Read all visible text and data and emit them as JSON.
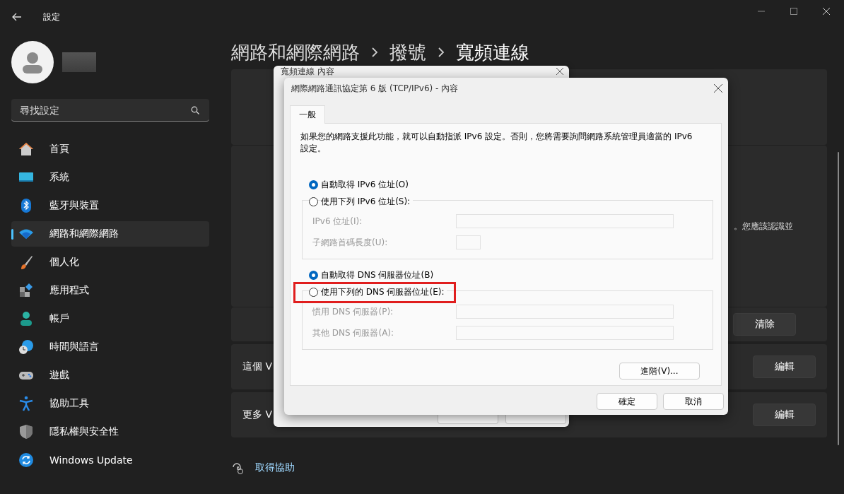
{
  "window": {
    "title": "設定"
  },
  "search": {
    "placeholder": "尋找設定"
  },
  "nav": [
    {
      "label": "首頁",
      "kind": "home",
      "selected": false
    },
    {
      "label": "系統",
      "kind": "system",
      "selected": false
    },
    {
      "label": "藍牙與裝置",
      "kind": "bluetooth",
      "selected": false
    },
    {
      "label": "網路和網際網路",
      "kind": "network",
      "selected": true
    },
    {
      "label": "個人化",
      "kind": "brush",
      "selected": false
    },
    {
      "label": "應用程式",
      "kind": "apps",
      "selected": false
    },
    {
      "label": "帳戶",
      "kind": "account",
      "selected": false
    },
    {
      "label": "時間與語言",
      "kind": "time",
      "selected": false
    },
    {
      "label": "遊戲",
      "kind": "gaming",
      "selected": false
    },
    {
      "label": "協助工具",
      "kind": "accessibility",
      "selected": false
    },
    {
      "label": "隱私權與安全性",
      "kind": "privacy",
      "selected": false
    },
    {
      "label": "Windows Update",
      "kind": "update",
      "selected": false
    }
  ],
  "breadcrumb": [
    "網路和網際網路",
    "撥號",
    "寬頻連線"
  ],
  "cards": [
    {
      "kind": "blank"
    },
    {
      "kind": "note",
      "text": "。您應該認識並"
    },
    {
      "kind": "action",
      "button": "清除"
    },
    {
      "kind": "row",
      "label": "這個 V",
      "button": "編輯"
    },
    {
      "kind": "row",
      "label": "更多 V",
      "button": "編輯"
    }
  ],
  "help_link": "取得協助",
  "back_dialog": {
    "title": "寬頻連線 內容"
  },
  "dialog": {
    "title": "網際網路通訊協定第 6 版 (TCP/IPv6) - 內容",
    "tabs": [
      {
        "label": "一般",
        "selected": true
      }
    ],
    "description": "如果您的網路支援此功能，就可以自動指派 IPv6 設定。否則，您將需要詢問網路系統管理員適當的 IPv6 設定。",
    "sections": [
      {
        "options": [
          {
            "label": "自動取得 IPv6 位址(O)",
            "selected": true
          },
          {
            "label": "使用下列 IPv6 位址(S):",
            "selected": false
          }
        ],
        "fields": [
          {
            "label": "IPv6 位址(I):",
            "kind": "wide",
            "disabled": true
          },
          {
            "label": "子網路首碼長度(U):",
            "kind": "short",
            "disabled": true
          }
        ]
      },
      {
        "options": [
          {
            "label": "自動取得 DNS 伺服器位址(B)",
            "selected": true
          },
          {
            "label": "使用下列的 DNS 伺服器位址(E):",
            "selected": false,
            "highlighted": true
          }
        ],
        "fields": [
          {
            "label": "慣用 DNS 伺服器(P):",
            "kind": "wide",
            "disabled": true
          },
          {
            "label": "其他 DNS 伺服器(A):",
            "kind": "wide",
            "disabled": true
          }
        ]
      }
    ],
    "advanced_button": "進階(V)...",
    "buttons": [
      "確定",
      "取消"
    ]
  }
}
